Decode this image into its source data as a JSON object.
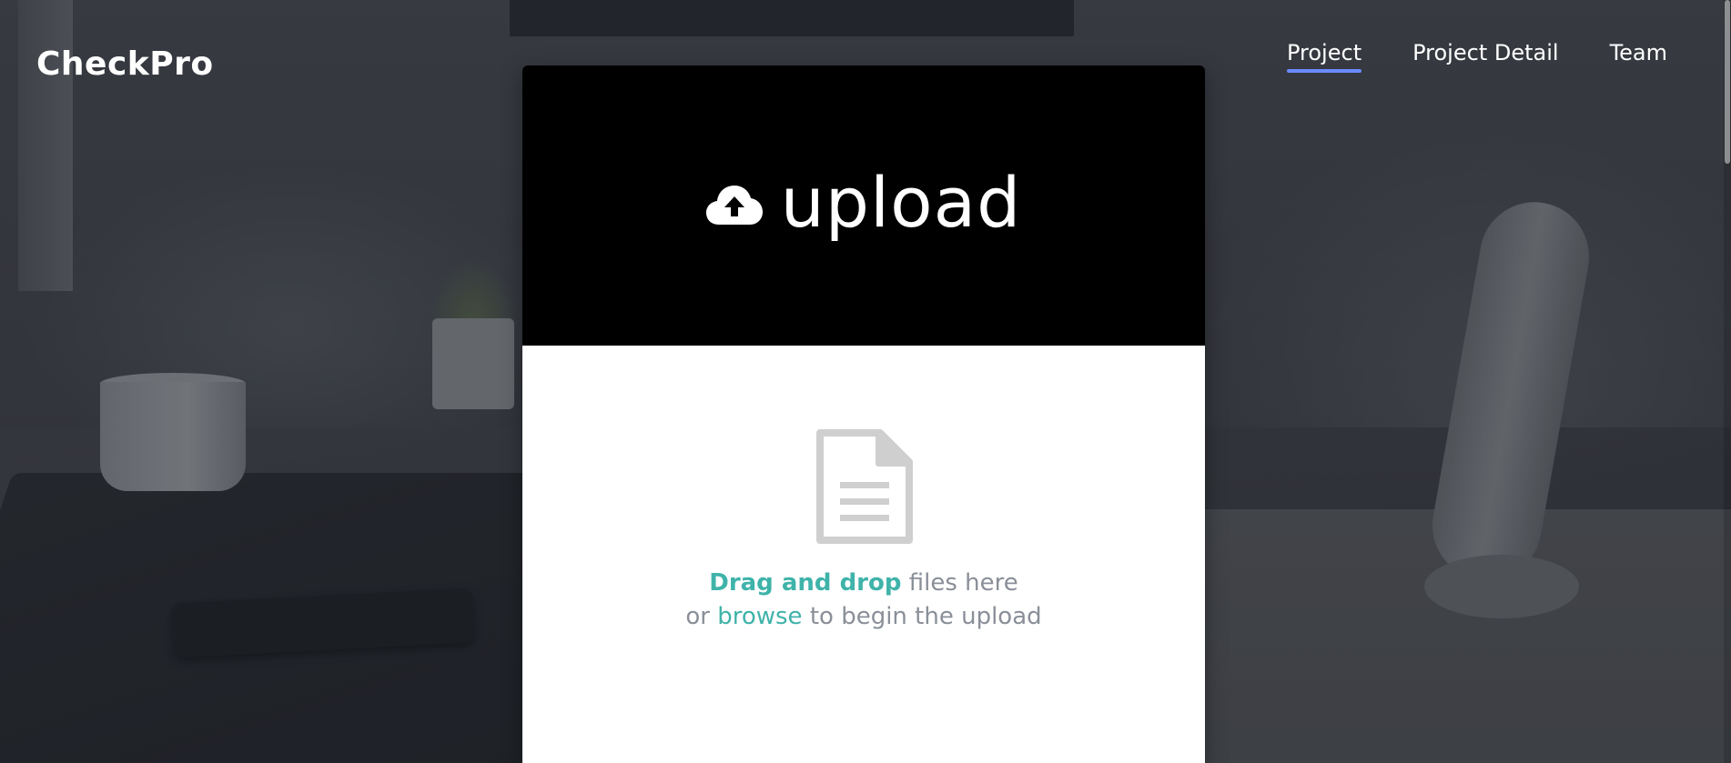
{
  "app": {
    "brand": "CheckPro"
  },
  "nav": {
    "items": [
      {
        "label": "Project",
        "active": true
      },
      {
        "label": "Project Detail",
        "active": false
      },
      {
        "label": "Team",
        "active": false
      }
    ],
    "active_underline_color": "#6a8cff"
  },
  "upload": {
    "title": "upload",
    "header_icon": "cloud-upload-icon",
    "body_icon": "document-icon",
    "drag_drop": "Drag and drop",
    "files_here": " files here",
    "or": "or ",
    "browse": "browse",
    "to_begin": " to begin the upload",
    "accent_color": "#3fb3aa",
    "muted_text_color": "#8a8f98"
  }
}
